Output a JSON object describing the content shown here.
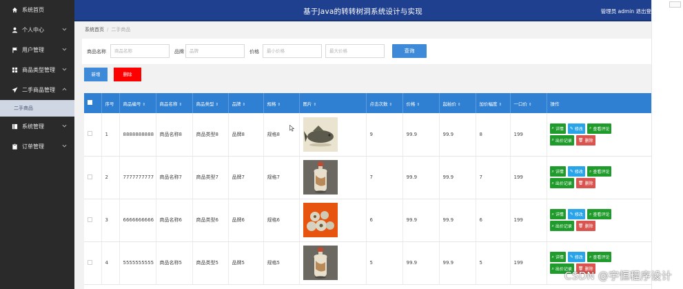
{
  "header": {
    "title": "基于Java的转转树洞系统设计与实现",
    "user": "管理员 admin  退出登"
  },
  "sidebar": {
    "items": [
      {
        "label": "系统首页",
        "icon": "home-icon"
      },
      {
        "label": "个人中心",
        "icon": "user-icon"
      },
      {
        "label": "用户管理",
        "icon": "flag-icon"
      },
      {
        "label": "商品类型管理",
        "icon": "grid-icon"
      },
      {
        "label": "二手商品管理",
        "icon": "send-icon"
      },
      {
        "label": "系统管理",
        "icon": "book-icon"
      },
      {
        "label": "订单管理",
        "icon": "clipboard-icon"
      }
    ],
    "active_sub": "二手商品"
  },
  "breadcrumb": {
    "home": "系统首页",
    "current": "二手商品"
  },
  "search": {
    "name_label": "商品名称",
    "name_placeholder": "商品名称",
    "brand_label": "品牌",
    "brand_placeholder": "品牌",
    "price_label": "价格",
    "min_placeholder": "最小价格",
    "max_placeholder": "最大价格",
    "query_button": "查询"
  },
  "toolbar": {
    "add": "新增",
    "delete": "删除"
  },
  "table": {
    "columns": [
      "序号",
      "商品编号",
      "商品名称",
      "商品类型",
      "品牌",
      "规格",
      "图片",
      "点击次数",
      "价格",
      "起拍价",
      "加价幅度",
      "一口价",
      "操作"
    ],
    "rows": [
      {
        "idx": "1",
        "code": "8888888888",
        "name": "商品名称8",
        "type": "商品类型8",
        "brand": "品牌8",
        "spec": "规格8",
        "image": "fish-statue",
        "clicks": "9",
        "price": "99.9",
        "start": "99.9",
        "step": "8",
        "buyout": "199"
      },
      {
        "idx": "2",
        "code": "7777777777",
        "name": "商品名称7",
        "type": "商品类型7",
        "brand": "品牌7",
        "spec": "规格7",
        "image": "snuff-bottle",
        "clicks": "7",
        "price": "99.9",
        "start": "99.9",
        "step": "7",
        "buyout": "199"
      },
      {
        "idx": "3",
        "code": "6666666666",
        "name": "商品名称6",
        "type": "商品类型6",
        "brand": "品牌6",
        "spec": "规格6",
        "image": "ornaments",
        "clicks": "6",
        "price": "99.9",
        "start": "99.9",
        "step": "6",
        "buyout": "199"
      },
      {
        "idx": "4",
        "code": "5555555555",
        "name": "商品名称5",
        "type": "商品类型5",
        "brand": "品牌5",
        "spec": "规格5",
        "image": "snuff-bottle",
        "clicks": "5",
        "price": "99.9",
        "start": "99.9",
        "step": "5",
        "buyout": "199"
      }
    ],
    "actions": {
      "detail": "详情",
      "edit": "修改",
      "reviews": "查看评论",
      "bids": "出价记录",
      "remove": "删除"
    }
  },
  "watermark": "CSDN @宇恒程序设计",
  "colors": {
    "header": "#1f3f8f",
    "sidebar": "#2a2a2a",
    "primary": "#3f8ad8",
    "danger": "#ff0000",
    "table_head": "#2f7fd3",
    "op_green": "#1f9b2c",
    "op_blue": "#2aa4e8",
    "op_red": "#d9534f"
  }
}
